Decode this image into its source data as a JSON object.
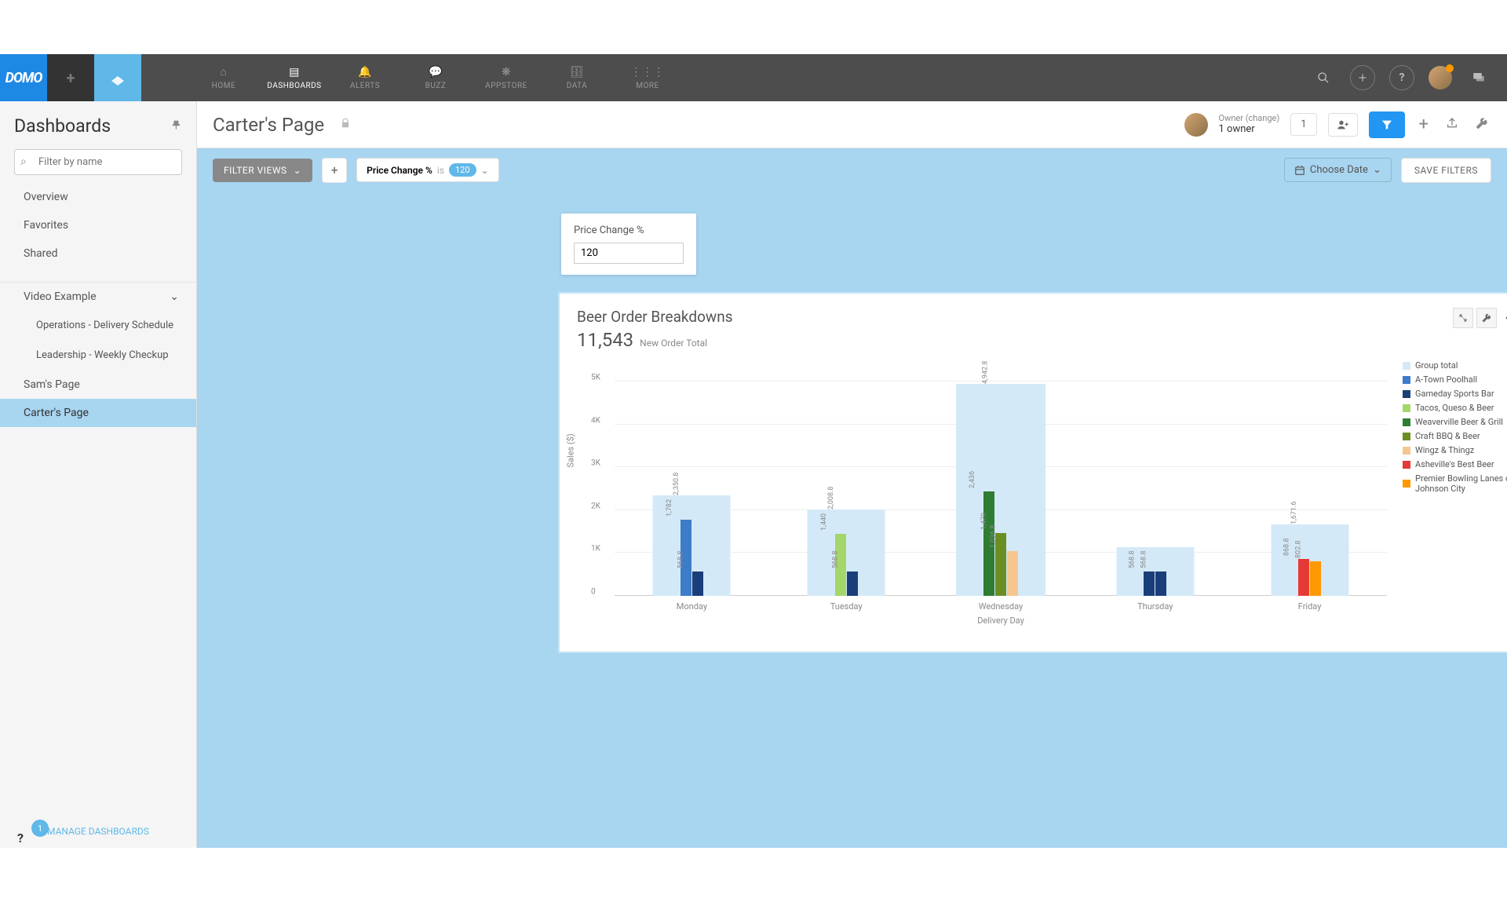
{
  "brand": "DOMO",
  "nav": {
    "items": [
      "HOME",
      "DASHBOARDS",
      "ALERTS",
      "BUZZ",
      "APPSTORE",
      "DATA",
      "MORE"
    ],
    "active": 1
  },
  "sidebar": {
    "title": "Dashboards",
    "filter_placeholder": "Filter by name",
    "links": [
      "Overview",
      "Favorites",
      "Shared"
    ],
    "section": "Video Example",
    "subs": [
      "Operations - Delivery Schedule",
      "Leadership - Weekly Checkup"
    ],
    "pages": [
      "Sam's Page",
      "Carter's Page"
    ],
    "active_page": 1,
    "manage": "MANAGE DASHBOARDS",
    "badge": "1"
  },
  "page": {
    "title": "Carter's Page",
    "owner_label": "Owner (change)",
    "owner_count": "1 owner",
    "count_badge": "1"
  },
  "filterbar": {
    "views_label": "FILTER VIEWS",
    "chip_field": "Price Change %",
    "chip_op": "is",
    "chip_val": "120",
    "choose_date": "Choose Date",
    "save": "SAVE FILTERS"
  },
  "control": {
    "label": "Price Change %",
    "value": "120"
  },
  "card": {
    "title": "Beer Order Breakdowns",
    "big": "11,543",
    "small": "New Order Total"
  },
  "chart_data": {
    "type": "bar",
    "title": "Beer Order Breakdowns",
    "xlabel": "Delivery Day",
    "ylabel": "Sales ($)",
    "ylim": [
      0,
      5500
    ],
    "yticks": [
      0,
      "1K",
      "2K",
      "3K",
      "4K",
      "5K"
    ],
    "categories": [
      "Monday",
      "Tuesday",
      "Wednesday",
      "Thursday",
      "Friday"
    ],
    "group_totals": [
      2350.8,
      2008.8,
      4942.8,
      1137.6,
      1671.6
    ],
    "group_labels": [
      "2,350.8",
      "2,008.8",
      "4,942.8",
      "",
      "1,671.6"
    ],
    "legend": [
      {
        "name": "Group total",
        "color": "#d4e9f7"
      },
      {
        "name": "A-Town Poolhall",
        "color": "#3d7cc9"
      },
      {
        "name": "Gameday Sports Bar",
        "color": "#1a3e7a"
      },
      {
        "name": "Tacos, Queso & Beer",
        "color": "#a5d66a"
      },
      {
        "name": "Weaverville Beer & Grill",
        "color": "#2e7d32"
      },
      {
        "name": "Craft BBQ & Beer",
        "color": "#6b8e23"
      },
      {
        "name": "Wingz & Thingz",
        "color": "#f5c78e"
      },
      {
        "name": "Asheville's Best Beer",
        "color": "#e53935"
      },
      {
        "name": "Premier Bowling Lanes of Johnson City",
        "color": "#ff9800"
      }
    ],
    "bars": {
      "Monday": [
        {
          "series": "A-Town Poolhall",
          "value": 1782,
          "label": "1,782",
          "color": "#3d7cc9"
        },
        {
          "series": "Gameday Sports Bar",
          "value": 568.8,
          "label": "568.8",
          "color": "#1a3e7a"
        }
      ],
      "Tuesday": [
        {
          "series": "Tacos, Queso & Beer",
          "value": 1440,
          "label": "1,440",
          "color": "#a5d66a"
        },
        {
          "series": "Gameday Sports Bar",
          "value": 568.8,
          "label": "568.8",
          "color": "#1a3e7a"
        }
      ],
      "Wednesday": [
        {
          "series": "Weaverville Beer & Grill",
          "value": 2436,
          "label": "2,436",
          "color": "#2e7d32"
        },
        {
          "series": "Craft BBQ & Beer",
          "value": 1470,
          "label": "1,470",
          "color": "#6b8e23"
        },
        {
          "series": "Wingz & Thingz",
          "value": 1036.8,
          "label": "1,036.8",
          "color": "#f5c78e"
        }
      ],
      "Thursday": [
        {
          "series": "Gameday Sports Bar",
          "value": 568.8,
          "label": "568.8",
          "color": "#1a3e7a"
        },
        {
          "series": "Gameday Sports Bar",
          "value": 568.8,
          "label": "568.8",
          "color": "#1a3e7a"
        }
      ],
      "Friday": [
        {
          "series": "Asheville's Best Beer",
          "value": 868.8,
          "label": "868.8",
          "color": "#e53935"
        },
        {
          "series": "Premier Bowling Lanes of Johnson City",
          "value": 802.8,
          "label": "802.8",
          "color": "#ff9800"
        }
      ]
    }
  }
}
